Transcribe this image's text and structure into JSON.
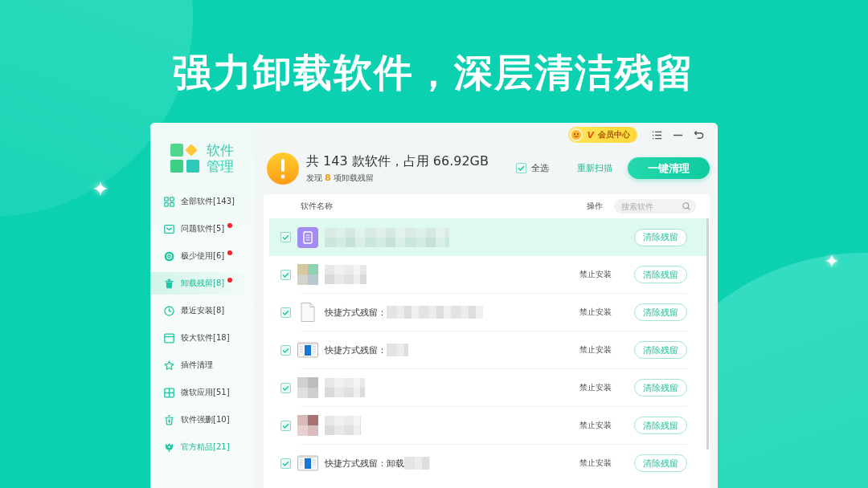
{
  "banner": {
    "title": "强力卸载软件，深层清洁残留"
  },
  "sidebar": {
    "logo_text": "软件管理",
    "items": [
      {
        "label": "全部软件[143]",
        "kind": "category",
        "selected": false,
        "alert": false
      },
      {
        "label": "问题软件[5]",
        "kind": "category",
        "selected": false,
        "alert": true
      },
      {
        "label": "极少使用[6]",
        "kind": "category",
        "selected": false,
        "alert": true
      },
      {
        "label": "卸载残留[8]",
        "kind": "category",
        "selected": true,
        "alert": true
      },
      {
        "label": "最近安装[8]",
        "kind": "category",
        "selected": false,
        "alert": false
      },
      {
        "label": "较大软件[18]",
        "kind": "category",
        "selected": false,
        "alert": false
      },
      {
        "label": "插件清理",
        "kind": "category",
        "selected": false,
        "alert": false
      },
      {
        "label": "微软应用[51]",
        "kind": "category",
        "selected": false,
        "alert": false
      },
      {
        "label": "软件强删[10]",
        "kind": "category",
        "selected": false,
        "alert": false
      },
      {
        "label": "官方精品[21]",
        "kind": "featured",
        "selected": false,
        "alert": false
      }
    ]
  },
  "top_bar": {
    "vip_mark": "V",
    "vip_label": "会员中心"
  },
  "summary": {
    "headline": "共 143 款软件，占用 66.92GB",
    "found_prefix": "发现",
    "found_count": "8",
    "found_suffix": "项卸载残留",
    "select_all": {
      "label": "全选",
      "checked": true
    },
    "rescan_link": "重新扫描",
    "clean_button": "一键清理"
  },
  "table": {
    "columns": [
      "软件名称",
      "操作"
    ],
    "search": {
      "placeholder": "搜索软件"
    },
    "rows": [
      {
        "kind": "document",
        "selected": true,
        "checked": true,
        "button": "清除残留"
      },
      {
        "kind": "blurred",
        "selected": false,
        "checked": true,
        "action": "禁止安装",
        "button": "清除残留"
      },
      {
        "kind": "file",
        "label": "快捷方式残留：",
        "selected": false,
        "checked": true,
        "action": "禁止安装",
        "button": "清除残留"
      },
      {
        "kind": "window",
        "label": "快捷方式残留：",
        "selected": false,
        "checked": true,
        "action": "禁止安装",
        "button": "清除残留"
      },
      {
        "kind": "blurred",
        "selected": false,
        "checked": true,
        "action": "禁止安装",
        "button": "清除残留"
      },
      {
        "kind": "blurred",
        "selected": false,
        "checked": true,
        "action": "禁止安装",
        "button": "清除残留"
      },
      {
        "kind": "window",
        "label": "快捷方式残留：卸载",
        "selected": false,
        "checked": true,
        "action": "禁止安装",
        "button": "清除残留"
      }
    ]
  }
}
